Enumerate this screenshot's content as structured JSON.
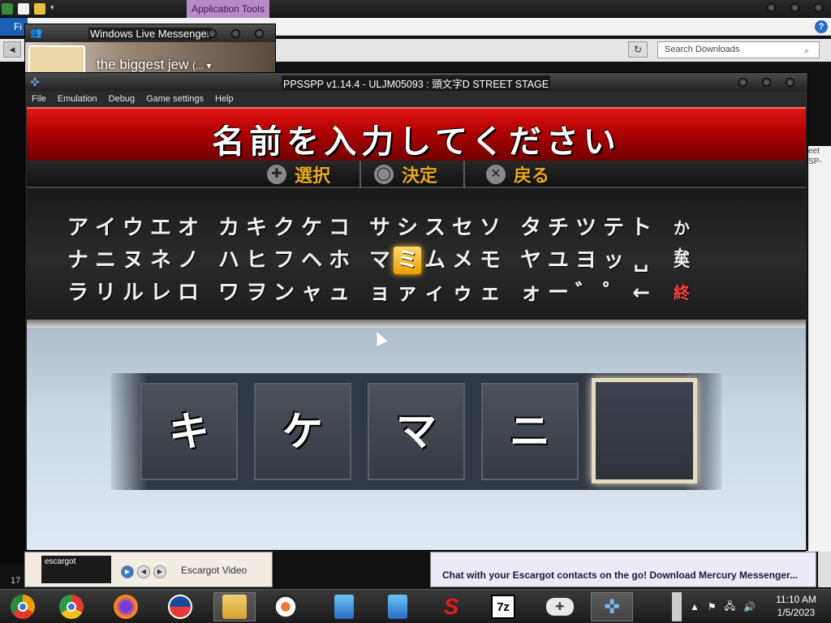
{
  "explorer": {
    "file_tab": "Fi",
    "app_tools": "Application Tools",
    "help": "?",
    "search_placeholder": "Search Downloads",
    "side_fragment": "eet\nSP-",
    "left_count": "17"
  },
  "messenger": {
    "title": "Windows Live Messenger",
    "contact_name": "the biggest jew",
    "contact_suffix": "(... ▾"
  },
  "ppsspp": {
    "title": "PPSSPP v1.14.4 - ULJM05093 : 頭文字D  STREET  STAGE",
    "menu": [
      "File",
      "Emulation",
      "Debug",
      "Game settings",
      "Help"
    ],
    "game": {
      "header": "名前を入力してください",
      "controls": [
        {
          "icon": "✚",
          "label": "選択"
        },
        {
          "icon": "◯",
          "label": "決定"
        },
        {
          "icon": "✕",
          "label": "戻る"
        }
      ],
      "keyboard": {
        "row1": [
          "ア",
          "イ",
          "ウ",
          "エ",
          "オ",
          "カ",
          "キ",
          "ク",
          "ケ",
          "コ",
          "サ",
          "シ",
          "ス",
          "セ",
          "ソ",
          "タ",
          "チ",
          "ツ",
          "テ",
          "ト",
          "かな"
        ],
        "row2": [
          "ナ",
          "ニ",
          "ヌ",
          "ネ",
          "ノ",
          "ハ",
          "ヒ",
          "フ",
          "ヘ",
          "ホ",
          "マ",
          "ミ",
          "ム",
          "メ",
          "モ",
          "ヤ",
          "ユ",
          "ヨ",
          "ッ",
          "␣",
          "英"
        ],
        "row3": [
          "ラ",
          "リ",
          "ル",
          "レ",
          "ロ",
          "ワ",
          "ヲ",
          "ン",
          "ャ",
          "ュ",
          "ョ",
          "ァ",
          "ィ",
          "ゥ",
          "ェ",
          "ォ",
          "ー",
          "゛",
          "゜",
          "←",
          "終"
        ]
      },
      "selected_key": "ミ",
      "slots": [
        "キ",
        "ケ",
        "マ",
        "ニ",
        ""
      ]
    }
  },
  "media": {
    "thumb_text": "escargot",
    "title": "Escargot Video"
  },
  "mercury": {
    "text": "Chat with your Escargot contacts on the go! Download Mercury Messenger..."
  },
  "taskbar": {
    "apps": [
      "chrome-canary",
      "chrome",
      "firefox",
      "obama",
      "file-explorer",
      "sushi",
      "network-1",
      "network-2",
      "s-app",
      "7zip",
      "gamepad",
      "ppsspp"
    ],
    "labels": {
      "s_app": "S",
      "sevenzip": "7z"
    },
    "time": "11:10 AM",
    "date": "1/5/2023"
  }
}
